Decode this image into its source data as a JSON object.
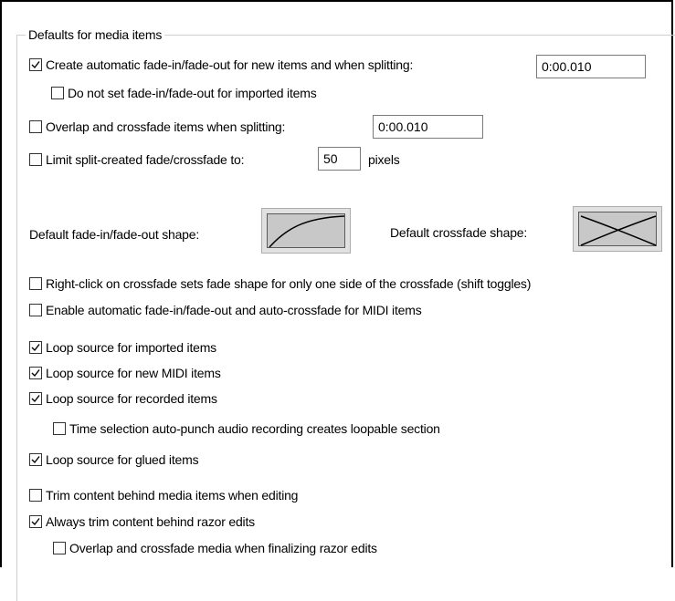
{
  "group": {
    "title": "Defaults for media items"
  },
  "fades": {
    "auto_fade": {
      "label": "Create automatic fade-in/fade-out for new items and when splitting:",
      "checked": true,
      "value": "0:00.010"
    },
    "no_imported_fade": {
      "label": "Do not set fade-in/fade-out for imported items",
      "checked": false
    },
    "overlap_split": {
      "label": "Overlap and crossfade items when splitting:",
      "checked": false,
      "value": "0:00.010"
    },
    "limit_split": {
      "label": "Limit split-created fade/crossfade to:",
      "checked": false,
      "value": "50",
      "unit": "pixels"
    }
  },
  "shapes": {
    "fade_label": "Default fade-in/fade-out shape:",
    "crossfade_label": "Default crossfade shape:"
  },
  "options": {
    "right_click_crossfade": {
      "label": "Right-click on crossfade sets fade shape for only one side of the crossfade (shift toggles)",
      "checked": false
    },
    "midi_auto_fade": {
      "label": "Enable automatic fade-in/fade-out and auto-crossfade for MIDI items",
      "checked": false
    },
    "loop_imported": {
      "label": "Loop source for imported items",
      "checked": true
    },
    "loop_new_midi": {
      "label": "Loop source for new MIDI items",
      "checked": true
    },
    "loop_recorded": {
      "label": "Loop source for recorded items",
      "checked": true
    },
    "time_selection_punch": {
      "label": "Time selection auto-punch audio recording creates loopable section",
      "checked": false
    },
    "loop_glued": {
      "label": "Loop source for glued items",
      "checked": true
    },
    "trim_behind": {
      "label": "Trim content behind media items when editing",
      "checked": false
    },
    "trim_razor": {
      "label": "Always trim content behind razor edits",
      "checked": true
    },
    "overlap_razor": {
      "label": "Overlap and crossfade media when finalizing razor edits",
      "checked": false
    }
  }
}
